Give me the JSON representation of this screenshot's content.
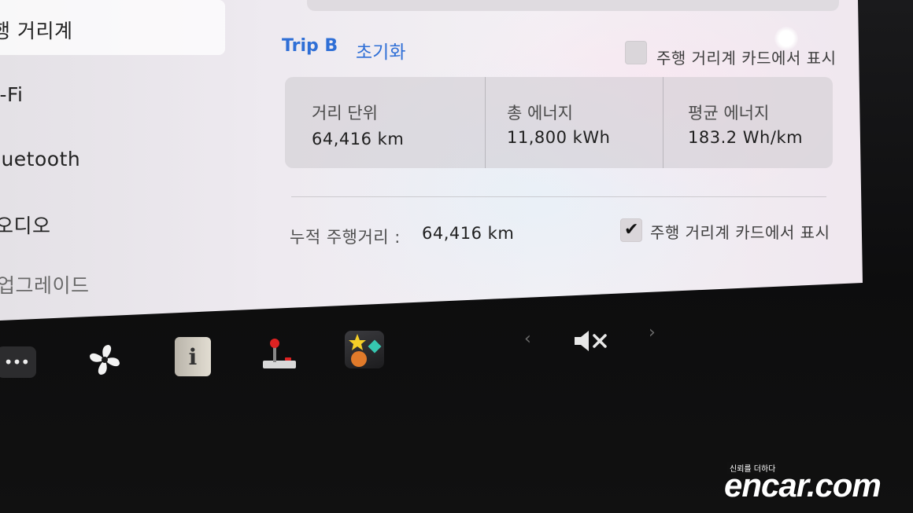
{
  "sidebar": {
    "items": [
      {
        "label": "행 거리계"
      },
      {
        "label": "i-Fi"
      },
      {
        "label": "luetooth"
      },
      {
        "label": "오디오"
      },
      {
        "label": "업그레이드"
      }
    ]
  },
  "trip": {
    "title": "Trip B",
    "reset_label": "초기화",
    "show_on_card_label": "주행 거리계 카드에서 표시",
    "show_on_card_checked": false,
    "stats": [
      {
        "label": "거리 단위",
        "value": "64,416 km"
      },
      {
        "label": "총 에너지",
        "value": "11,800 kWh"
      },
      {
        "label": "평균 에너지",
        "value": "183.2 Wh/km"
      }
    ]
  },
  "odometer": {
    "label": "누적 주행거리 :",
    "value": "64,416 km",
    "show_on_card_label": "주행 거리계 카드에서 표시",
    "show_on_card_checked": true,
    "check_glyph": "✔"
  },
  "taskbar": {
    "more_glyph": "•••",
    "manual_glyph": "i",
    "prev_glyph": "‹",
    "next_glyph": "›",
    "icons": [
      "more-icon",
      "fan-icon",
      "owners-manual-icon",
      "arcade-joystick-icon",
      "toybox-icon",
      "mute-icon"
    ]
  },
  "watermark": {
    "tagline": "신뢰를 더하다",
    "logo": "encar.com"
  },
  "colors": {
    "accent": "#2f6fd6",
    "screen_bg": "#efecf0",
    "bezel": "#0d0d0e"
  }
}
